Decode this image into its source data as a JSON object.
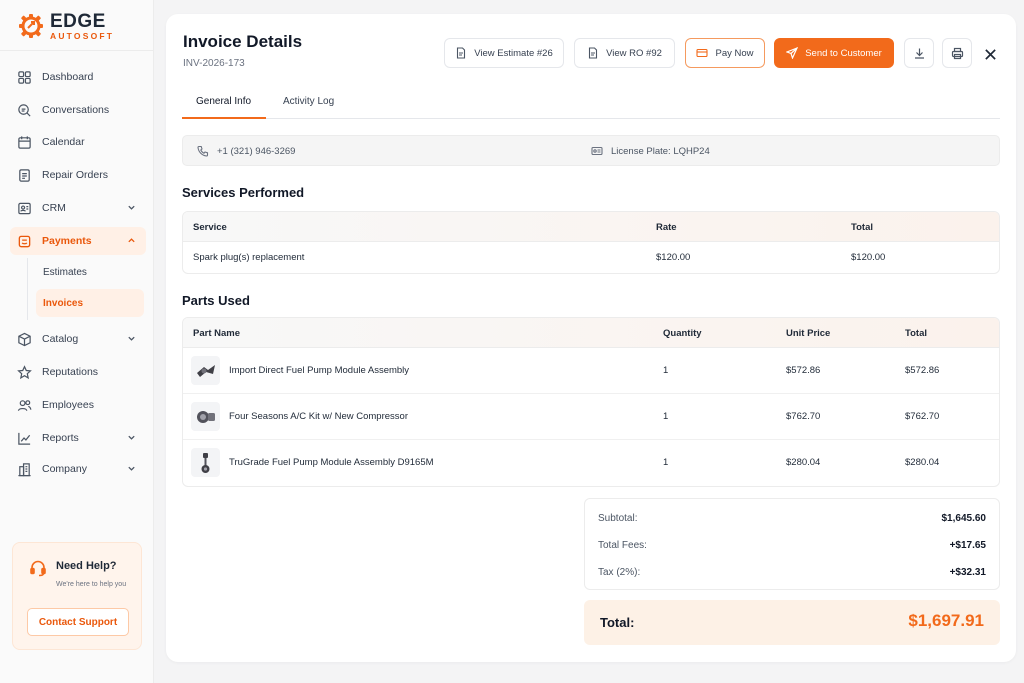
{
  "brand": {
    "name": "EDGE",
    "tagline": "AUTOSOFT",
    "accent": "#f26a1b"
  },
  "sidebar": {
    "items": [
      {
        "label": "Dashboard",
        "icon": "grid-icon"
      },
      {
        "label": "Conversations",
        "icon": "chat-icon"
      },
      {
        "label": "Calendar",
        "icon": "calendar-icon"
      },
      {
        "label": "Repair Orders",
        "icon": "clipboard-icon"
      },
      {
        "label": "CRM",
        "icon": "address-book-icon",
        "expandable": true
      },
      {
        "label": "Payments",
        "icon": "payment-icon",
        "expandable": true,
        "expanded": true,
        "active": true
      },
      {
        "label": "Catalog",
        "icon": "box-icon",
        "expandable": true
      },
      {
        "label": "Reputations",
        "icon": "star-icon"
      },
      {
        "label": "Employees",
        "icon": "users-icon"
      },
      {
        "label": "Reports",
        "icon": "chart-icon",
        "expandable": true
      },
      {
        "label": "Company",
        "icon": "building-icon",
        "expandable": true
      }
    ],
    "payments_sub": [
      {
        "label": "Estimates"
      },
      {
        "label": "Invoices",
        "active": true
      }
    ],
    "help": {
      "title": "Need Help?",
      "subtitle": "We're here to help you",
      "button": "Contact Support"
    }
  },
  "header": {
    "title": "Invoice Details",
    "invoice_number": "INV-2026-173",
    "buttons": {
      "view_estimate": "View Estimate #26",
      "view_ro": "View RO #92",
      "pay_now": "Pay Now",
      "send": "Send to Customer"
    }
  },
  "tabs": [
    {
      "label": "General Info",
      "active": true
    },
    {
      "label": "Activity Log"
    }
  ],
  "info": {
    "phone": "+1 (321) 946-3269",
    "license_plate": "License Plate: LQHP24"
  },
  "services": {
    "title": "Services Performed",
    "headers": [
      "Service",
      "Rate",
      "Total"
    ],
    "rows": [
      {
        "service": "Spark plug(s) replacement",
        "rate": "$120.00",
        "total": "$120.00"
      }
    ]
  },
  "parts": {
    "title": "Parts Used",
    "headers": [
      "Part Name",
      "Quantity",
      "Unit Price",
      "Total"
    ],
    "rows": [
      {
        "name": "Import Direct Fuel Pump Module Assembly",
        "qty": "1",
        "unit": "$572.86",
        "total": "$572.86",
        "thumb": "fuel-pump-icon"
      },
      {
        "name": "Four Seasons A/C Kit w/ New Compressor",
        "qty": "1",
        "unit": "$762.70",
        "total": "$762.70",
        "thumb": "compressor-icon"
      },
      {
        "name": "TruGrade Fuel Pump Module Assembly D9165M",
        "qty": "1",
        "unit": "$280.04",
        "total": "$280.04",
        "thumb": "pump-module-icon"
      }
    ]
  },
  "summary": {
    "subtotal_label": "Subtotal:",
    "subtotal": "$1,645.60",
    "fees_label": "Total Fees:",
    "fees": "+$17.65",
    "tax_label": "Tax (2%):",
    "tax": "+$32.31",
    "total_label": "Total:",
    "total": "$1,697.91"
  }
}
